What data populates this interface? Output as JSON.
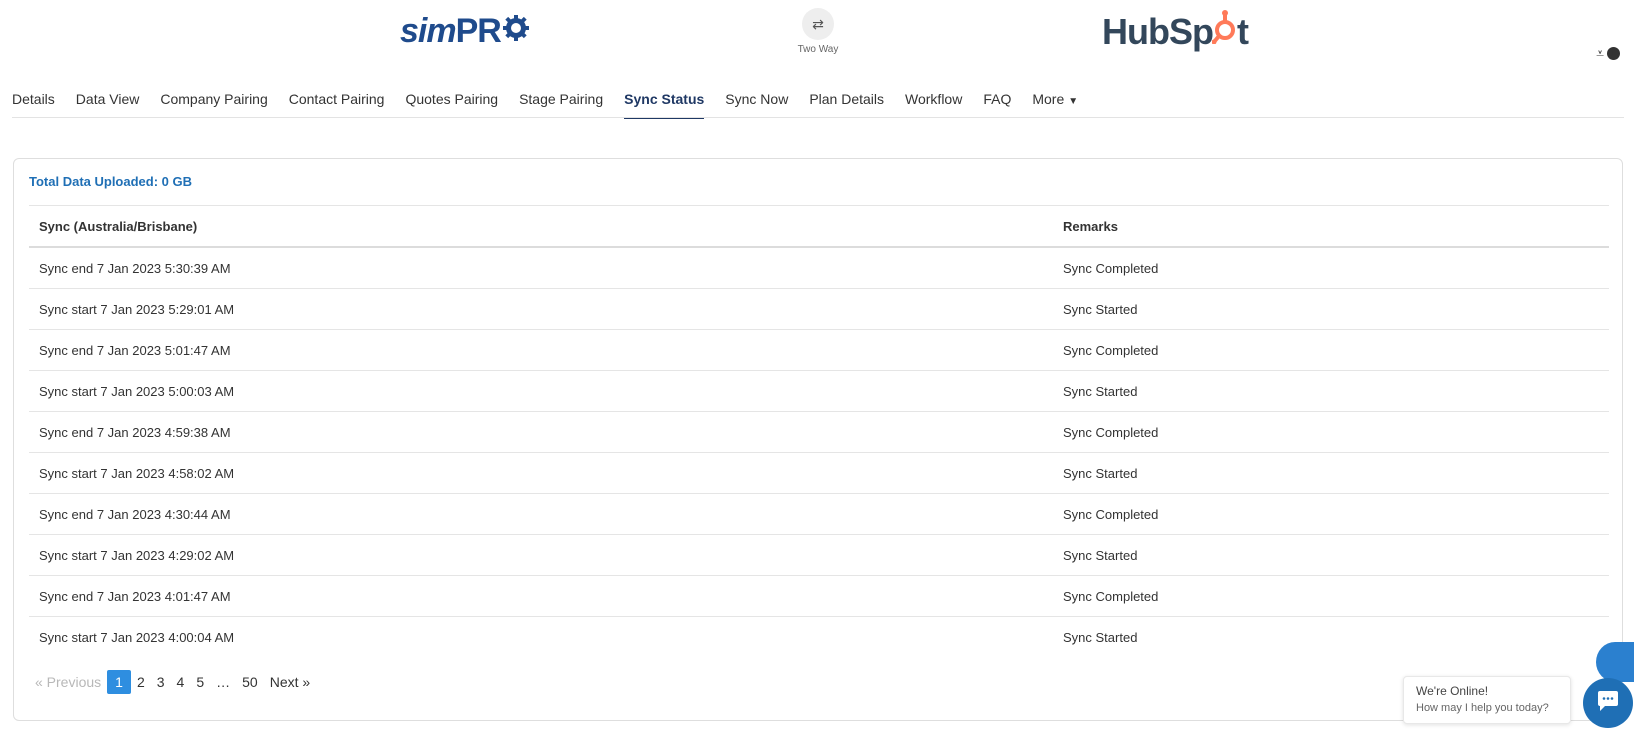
{
  "header": {
    "left_logo": {
      "text_main": "sim",
      "text_bold": "PR"
    },
    "right_logo": {
      "text_a": "HubSp",
      "text_b": "t"
    },
    "sync_direction": {
      "icon": "swap-arrows-icon",
      "label": "Two Way"
    },
    "icons": [
      "collapse-icon",
      "info-icon"
    ]
  },
  "nav": {
    "tabs": [
      {
        "label": "Details"
      },
      {
        "label": "Data View"
      },
      {
        "label": "Company Pairing"
      },
      {
        "label": "Contact Pairing"
      },
      {
        "label": "Quotes Pairing"
      },
      {
        "label": "Stage Pairing"
      },
      {
        "label": "Sync Status",
        "active": true
      },
      {
        "label": "Sync Now"
      },
      {
        "label": "Plan Details"
      },
      {
        "label": "Workflow"
      },
      {
        "label": "FAQ"
      },
      {
        "label": "More"
      }
    ]
  },
  "card": {
    "total_uploaded": "Total Data Uploaded: 0 GB",
    "table": {
      "headers": [
        "Sync (Australia/Brisbane)",
        "Remarks"
      ],
      "rows": [
        [
          "Sync end 7 Jan 2023 5:30:39 AM",
          "Sync Completed"
        ],
        [
          "Sync start 7 Jan 2023 5:29:01 AM",
          "Sync Started"
        ],
        [
          "Sync end 7 Jan 2023 5:01:47 AM",
          "Sync Completed"
        ],
        [
          "Sync start 7 Jan 2023 5:00:03 AM",
          "Sync Started"
        ],
        [
          "Sync end 7 Jan 2023 4:59:38 AM",
          "Sync Completed"
        ],
        [
          "Sync start 7 Jan 2023 4:58:02 AM",
          "Sync Started"
        ],
        [
          "Sync end 7 Jan 2023 4:30:44 AM",
          "Sync Completed"
        ],
        [
          "Sync start 7 Jan 2023 4:29:02 AM",
          "Sync Started"
        ],
        [
          "Sync end 7 Jan 2023 4:01:47 AM",
          "Sync Completed"
        ],
        [
          "Sync start 7 Jan 2023 4:00:04 AM",
          "Sync Started"
        ]
      ]
    },
    "pagination": {
      "previous": "«  Previous",
      "pages": [
        "1",
        "2",
        "3",
        "4",
        "5"
      ],
      "ellipsis": "…",
      "last": "50",
      "next": "Next  »",
      "current": "1"
    }
  },
  "chat": {
    "line1": "We're Online!",
    "line2": "How may I help you today?"
  },
  "colors": {
    "accent": "#1f3864",
    "link": "#1f6fb5",
    "page_active": "#2e8ee0",
    "hubspot_orange": "#ff7a59"
  }
}
